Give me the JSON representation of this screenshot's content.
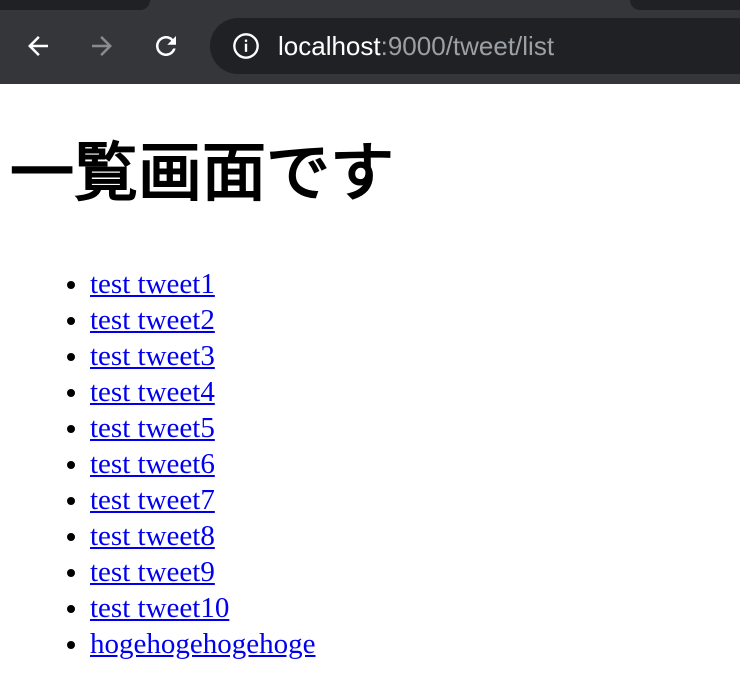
{
  "browser": {
    "url_host": "localhost",
    "url_path": ":9000/tweet/list",
    "icons": {
      "back": "arrow-left-icon",
      "forward": "arrow-right-icon",
      "reload": "reload-icon",
      "info": "info-icon"
    }
  },
  "page": {
    "title": "一覧画面です",
    "tweets": [
      "test tweet1",
      "test tweet2",
      "test tweet3",
      "test tweet4",
      "test tweet5",
      "test tweet6",
      "test tweet7",
      "test tweet8",
      "test tweet9",
      "test tweet10",
      "hogehogehogehoge"
    ]
  },
  "colors": {
    "toolbar": "#35363a",
    "omnibox": "#202124",
    "link": "#0000ee"
  }
}
